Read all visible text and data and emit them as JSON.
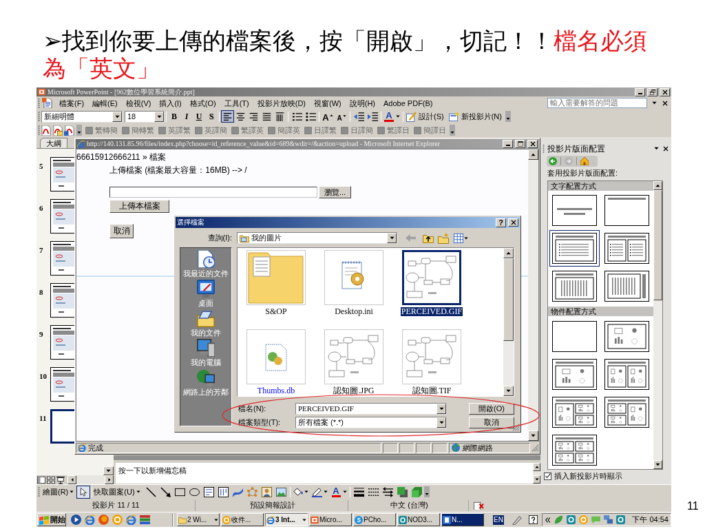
{
  "slide": {
    "heading": {
      "text": "➢找到你要上傳的檔案後，按「開啟」，切記！！",
      "emphasis": "檔名必須為「英文」"
    },
    "page_number": "11"
  },
  "powerpoint": {
    "title": "Microsoft PowerPoint - [962數位學習系統簡介.ppt]",
    "active": false,
    "menus": [
      "檔案(F)",
      "編輯(E)",
      "檢視(V)",
      "插入(I)",
      "格式(O)",
      "工具(T)",
      "投影片放映(D)",
      "視窗(W)",
      "說明(H)",
      "Adobe PDF(B)"
    ],
    "help_box": {
      "placeholder": "輸入需要解答的問題"
    },
    "formatting_toolbar": {
      "font": "新細明體",
      "size": "18",
      "style_buttons": [
        {
          "label": "B",
          "kind": "bold"
        },
        {
          "label": "I",
          "kind": "italic"
        },
        {
          "label": "U",
          "kind": "underline"
        },
        {
          "label": "S",
          "kind": "shadow"
        }
      ],
      "alignment": [
        {
          "kind": "left",
          "selected": true
        },
        {
          "kind": "center",
          "selected": false
        },
        {
          "kind": "right",
          "selected": false
        },
        {
          "kind": "distributed",
          "selected": false
        },
        {
          "kind": "columns",
          "selected": false
        }
      ],
      "grow_font": "A",
      "shrink_font": "A",
      "font_color": "A",
      "design": "設計(S)",
      "new_slide": "新投影片(N)"
    },
    "translate_toolbar": [
      {
        "label": "繁轉簡",
        "disabled": true
      },
      {
        "label": "簡轉繁",
        "disabled": true
      },
      {
        "label": "英譯繁",
        "disabled": true
      },
      {
        "label": "英譯簡",
        "disabled": true
      },
      {
        "label": "繁譯英",
        "disabled": true
      },
      {
        "label": "簡譯英",
        "disabled": true
      },
      {
        "label": "日譯繁",
        "disabled": true
      },
      {
        "label": "日譯簡",
        "disabled": true
      },
      {
        "label": "繁譯日",
        "disabled": true
      },
      {
        "label": "簡譯日",
        "disabled": true
      }
    ],
    "outline_tab": {
      "label": "大綱",
      "selected": false
    },
    "thumbnails": [
      {
        "number": "5",
        "kind": "screenshot",
        "selected": false
      },
      {
        "number": "6",
        "kind": "screenshot",
        "selected": false
      },
      {
        "number": "7",
        "kind": "screenshot",
        "selected": false
      },
      {
        "number": "8",
        "kind": "screenshot",
        "selected": false
      },
      {
        "number": "9",
        "kind": "screenshot",
        "selected": false
      },
      {
        "number": "10",
        "kind": "screenshot",
        "selected": false
      },
      {
        "number": "11",
        "kind": "blank",
        "selected": true
      }
    ],
    "notes": {
      "placeholder": "按一下以新增備忘稿"
    },
    "task_pane": {
      "title": "投影片版面配置",
      "prompt": "套用投影片版面配置:",
      "sections": [
        {
          "title": "文字配置方式",
          "layouts": [
            {
              "kind": "title",
              "selected": false
            },
            {
              "kind": "title-only",
              "selected": false
            },
            {
              "kind": "title-text",
              "selected": true
            },
            {
              "kind": "two-column-text",
              "selected": false
            },
            {
              "kind": "vertical-text",
              "selected": false
            },
            {
              "kind": "title-vertical-text",
              "selected": false
            }
          ]
        },
        {
          "title": "物件配置方式",
          "layouts": [
            {
              "kind": "blank",
              "selected": false
            },
            {
              "kind": "content",
              "selected": false
            },
            {
              "kind": "title-content",
              "selected": false
            },
            {
              "kind": "title-two-content",
              "selected": false
            },
            {
              "kind": "title-content-two",
              "selected": false
            },
            {
              "kind": "title-two-content-right",
              "selected": false
            },
            {
              "kind": "title-four-content",
              "selected": false
            }
          ]
        }
      ],
      "show_on_insert": {
        "label": "插入新投影片時顯示",
        "checked": true
      }
    },
    "drawing_toolbar": {
      "draw_menu": "繪圖(R)",
      "pointer": {
        "selected": true
      },
      "autoshapes_menu": "快取圖案(U)",
      "font_color": "A"
    },
    "status_bar": [
      "投影片 11 / 11",
      "預設簡報設計",
      "中文 (台灣)"
    ]
  },
  "browser": {
    "title": "http://140.131.85.96/files/index.php?choose=id_reference_value&id=689&wdir=/&action=upload - Microsoft Internet Explorer",
    "active": false,
    "breadcrumb": "66615912666211 » 檔案",
    "upload_caption": "上傳檔案 (檔案最大容量：16MB) --> /",
    "browse_button": "瀏覽...",
    "upload_button": "上傳本檔案",
    "cancel_button": "取消",
    "status_text": "完成",
    "zone": "網際網路"
  },
  "file_dialog": {
    "title": "選擇檔案",
    "active": true,
    "help_button": "?",
    "look_in_label": "查詢(I):",
    "look_in_value": "我的圖片",
    "places": [
      {
        "label": "我最近的文件",
        "kind": "recent",
        "selected": false
      },
      {
        "label": "桌面",
        "kind": "desktop",
        "selected": false
      },
      {
        "label": "我的文件",
        "kind": "documents",
        "selected": false
      },
      {
        "label": "我的電腦",
        "kind": "computer",
        "selected": false
      },
      {
        "label": "網路上的芳鄰",
        "kind": "network",
        "selected": false
      }
    ],
    "files": [
      {
        "name": "S&OP",
        "kind": "folder",
        "selected": false,
        "compressed": false
      },
      {
        "name": "Desktop.ini",
        "kind": "settings",
        "selected": false,
        "compressed": false
      },
      {
        "name": "PERCEIVED.GIF",
        "kind": "diagram",
        "selected": true,
        "compressed": false
      },
      {
        "name": "Thumbs.db",
        "kind": "system",
        "selected": false,
        "compressed": true
      },
      {
        "name": "認知圖.JPG",
        "kind": "diagram",
        "selected": false,
        "compressed": false
      },
      {
        "name": "認知圖.TIF",
        "kind": "diagram",
        "selected": false,
        "compressed": false
      }
    ],
    "file_name_label": "檔名(N):",
    "file_name_value": "PERCEIVED.GIF",
    "file_type_label": "檔案類型(T):",
    "file_type_value": "所有檔案 (*.*)",
    "open_button": "開啟(O)",
    "cancel_button": "取消"
  },
  "taskbar": {
    "start": "開始",
    "tasks": [
      {
        "label": "2 Wi...",
        "kind": "folder",
        "grouped": true,
        "selected": false,
        "flashing": false
      },
      {
        "label": "收件...",
        "kind": "mail",
        "grouped": false,
        "selected": false,
        "flashing": false
      },
      {
        "label": "3 Int...",
        "kind": "browser",
        "grouped": true,
        "selected": true,
        "flashing": false
      },
      {
        "label": "Micro...",
        "kind": "slides",
        "grouped": false,
        "selected": false,
        "flashing": false
      },
      {
        "label": "PCho...",
        "kind": "phone",
        "grouped": false,
        "selected": false,
        "flashing": false
      },
      {
        "label": "NOD3...",
        "kind": "shield",
        "grouped": false,
        "selected": false,
        "flashing": false
      },
      {
        "label": "N...",
        "kind": "app",
        "grouped": false,
        "selected": false,
        "flashing": true
      }
    ],
    "language": "EN",
    "clock": "下午 04:54"
  }
}
